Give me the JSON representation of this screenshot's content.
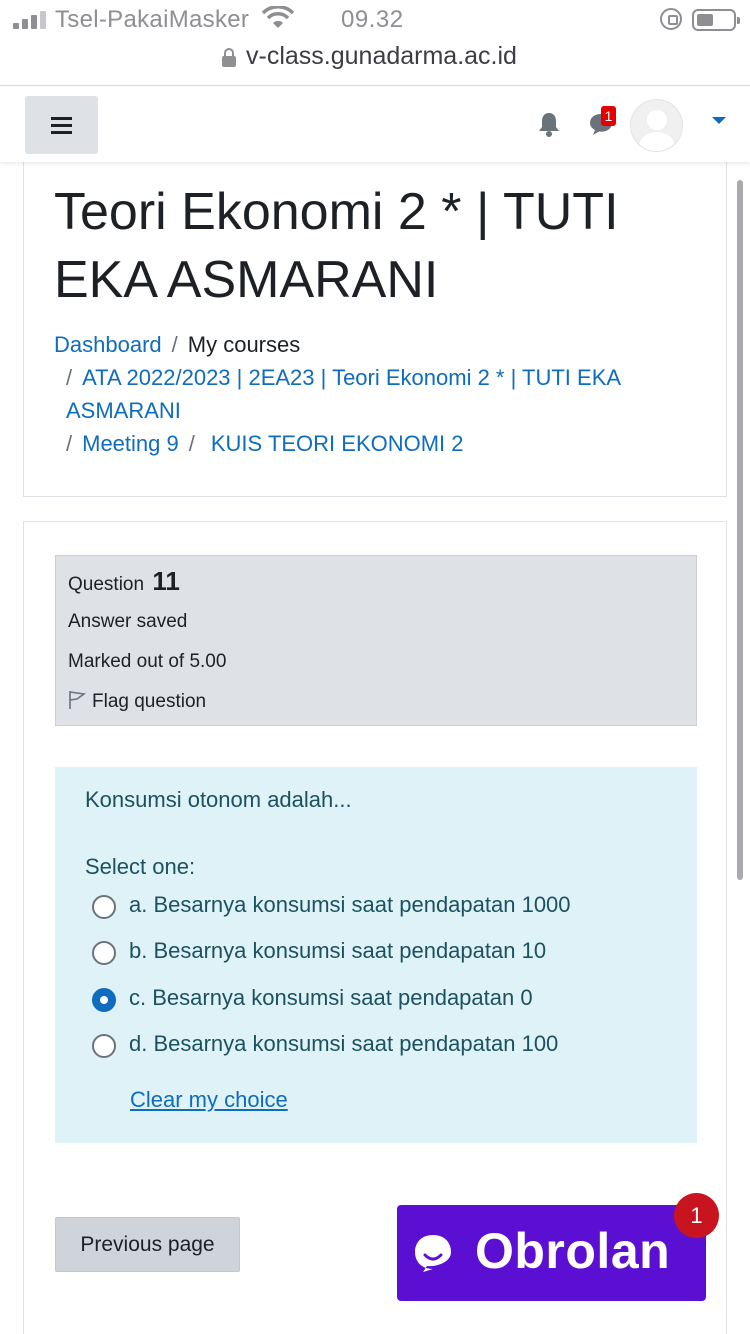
{
  "status_bar": {
    "carrier": "Tsel-PakaiMasker",
    "time": "09.32",
    "url": "v-class.gunadarma.ac.id"
  },
  "navbar": {
    "icons": [
      "hamburger-menu-icon",
      "bell-icon",
      "chat-icon",
      "user-avatar-icon",
      "caret-down-icon"
    ],
    "message_badge": "1"
  },
  "header": {
    "title": "Teori Ekonomi 2 * | TUTI EKA ASMARANI",
    "breadcrumb": [
      "Dashboard",
      "My courses",
      "ATA 2022/2023 | 2EA23 | Teori Ekonomi 2 * | TUTI EKA ASMARANI",
      "Meeting 9",
      "KUIS TEORI EKONOMI 2"
    ]
  },
  "question": {
    "label": "Question",
    "number": "11",
    "state": "Answer saved",
    "grade": "Marked out of 5.00",
    "flag_label": "Flag question",
    "text": "Konsumsi otonom adalah...",
    "prompt": "Select one:",
    "options": [
      {
        "label": "a. Besarnya konsumsi saat pendapatan 1000",
        "selected": false
      },
      {
        "label": "b. Besarnya konsumsi saat pendapatan 10",
        "selected": false
      },
      {
        "label": "c. Besarnya konsumsi saat pendapatan 0",
        "selected": true
      },
      {
        "label": "d. Besarnya konsumsi saat pendapatan 100",
        "selected": false
      }
    ],
    "clear_label": "Clear my choice"
  },
  "navigation": {
    "previous_label": "Previous page"
  },
  "chat_widget": {
    "label": "Obrolan",
    "badge": "1",
    "color": "#5b0fd2"
  },
  "colors": {
    "link": "#0f6cbf",
    "answer_bg": "#def2f8",
    "info_bg": "#dee2e6"
  }
}
